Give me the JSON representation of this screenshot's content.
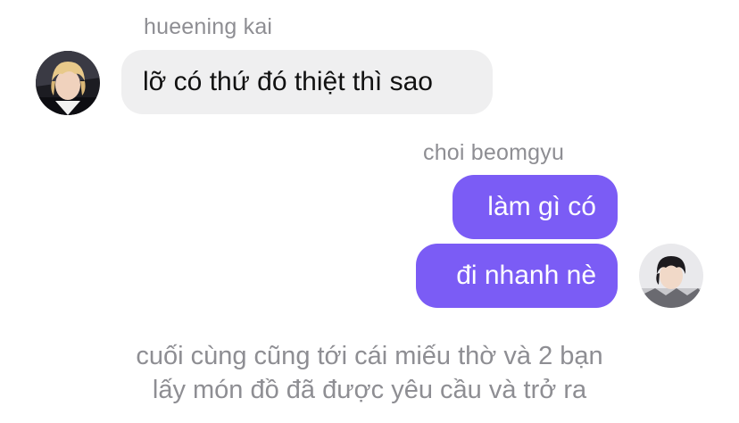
{
  "colors": {
    "incoming_bubble": "#efeff0",
    "outgoing_bubble": "#7b5cf5",
    "name_text": "#8e8e93",
    "narration_text": "#8e8e93"
  },
  "messages": [
    {
      "sender": "hueening kai",
      "direction": "incoming",
      "avatar_icon": "person-avatar-blonde-hair",
      "bubbles": [
        "lỡ có thứ đó thiệt thì sao"
      ]
    },
    {
      "sender": "choi beomgyu",
      "direction": "outgoing",
      "avatar_icon": "person-avatar-dark-hair",
      "bubbles": [
        "làm gì có",
        "đi nhanh nè"
      ]
    }
  ],
  "narration": {
    "lines": [
      "cuối cùng cũng tới cái miếu thờ và 2 bạn",
      "lấy món đồ đã được yêu cầu và trở ra"
    ]
  }
}
